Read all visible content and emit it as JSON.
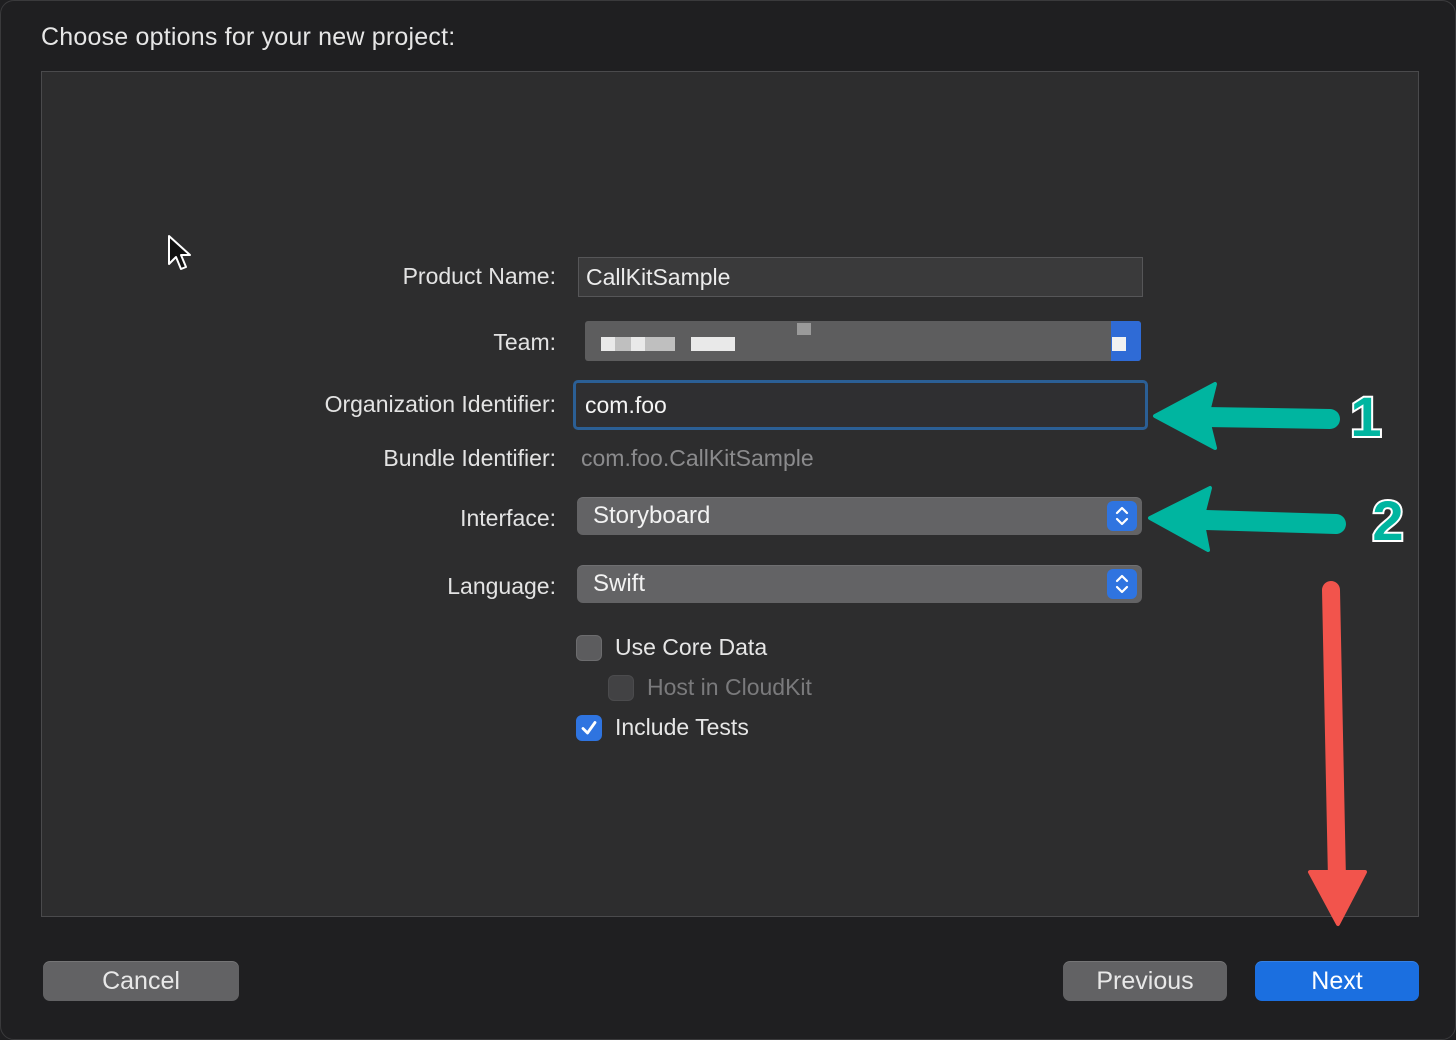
{
  "dialog": {
    "title": "Choose options for your new project:"
  },
  "form": {
    "product_name": {
      "label": "Product Name:",
      "value": "CallKitSample"
    },
    "team": {
      "label": "Team:"
    },
    "organization_identifier": {
      "label": "Organization Identifier:",
      "value": "com.foo"
    },
    "bundle_identifier": {
      "label": "Bundle Identifier:",
      "value": "com.foo.CallKitSample"
    },
    "interface": {
      "label": "Interface:",
      "selected": "Storyboard"
    },
    "language": {
      "label": "Language:",
      "selected": "Swift"
    },
    "options": [
      {
        "label": "Use Core Data",
        "checked": false,
        "enabled": true
      },
      {
        "label": "Host in CloudKit",
        "checked": false,
        "enabled": false
      },
      {
        "label": "Include Tests",
        "checked": true,
        "enabled": true
      }
    ]
  },
  "buttons": {
    "cancel": "Cancel",
    "previous": "Previous",
    "next": "Next"
  },
  "annotations": {
    "arrow_1_label": "1",
    "arrow_2_label": "2",
    "teal_color": "#00b5a0",
    "red_color": "#f2544c"
  },
  "colors": {
    "accent": "#1b6fe0",
    "focus_ring": "#2b5f95",
    "background": "#1f1f21",
    "panel": "#2d2d2e"
  }
}
